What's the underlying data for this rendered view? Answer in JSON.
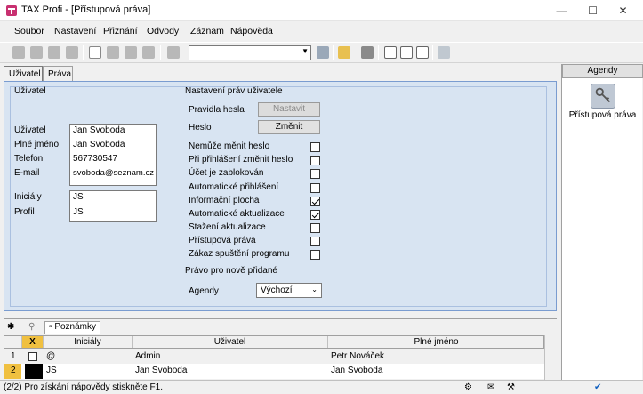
{
  "window": {
    "title": "TAX Profi - [Přístupová práva]"
  },
  "menu": [
    "Soubor",
    "Nastavení",
    "Přiznání",
    "Odvody",
    "Záznam",
    "Nápověda"
  ],
  "tabs": [
    "Uživatel",
    "Práva"
  ],
  "left_section": {
    "heading": "Uživatel",
    "fields": [
      {
        "label": "Uživatel",
        "value": "Jan Svoboda"
      },
      {
        "label": "Plné jméno",
        "value": "Jan Svoboda"
      },
      {
        "label": "Telefon",
        "value": "567730547"
      },
      {
        "label": "E-mail",
        "value": "svoboda@seznam.cz"
      },
      {
        "label": "Iniciály",
        "value": "JS"
      },
      {
        "label": "Profil",
        "value": "JS"
      }
    ]
  },
  "right_section": {
    "heading": "Nastavení práv uživatele",
    "password_rules_label": "Pravidla hesla",
    "password_rules_button": "Nastavit",
    "password_label": "Heslo",
    "password_button": "Změnit",
    "options": [
      {
        "label": "Nemůže měnit heslo",
        "checked": false
      },
      {
        "label": "Při přihlášení změnit heslo",
        "checked": false
      },
      {
        "label": "Účet je zablokován",
        "checked": false
      },
      {
        "label": "Automatické přihlášení",
        "checked": false
      },
      {
        "label": "Informační plocha",
        "checked": true
      },
      {
        "label": "Automatické aktualizace",
        "checked": true
      },
      {
        "label": "Stažení aktualizace",
        "checked": false
      },
      {
        "label": "Přístupová práva",
        "checked": false
      },
      {
        "label": "Zákaz spuštění programu",
        "checked": false
      }
    ],
    "new_items_heading": "Právo pro nově přidané",
    "agenda_label": "Agendy",
    "agenda_value": "Výchozí"
  },
  "right_panel": {
    "header": "Agendy",
    "item_label": "Přístupová práva"
  },
  "grid": {
    "toolbar_tab": "Poznámky",
    "columns": [
      "X",
      "Iniciály",
      "Uživatel",
      "Plné jméno"
    ],
    "rows": [
      {
        "num": "1",
        "ini": "@",
        "user": "Admin",
        "full": "Petr Nováček"
      },
      {
        "num": "2",
        "ini": "JS",
        "user": "Jan Svoboda",
        "full": "Jan Svoboda"
      }
    ]
  },
  "status": "(2/2)  Pro získání nápovědy stiskněte F1."
}
